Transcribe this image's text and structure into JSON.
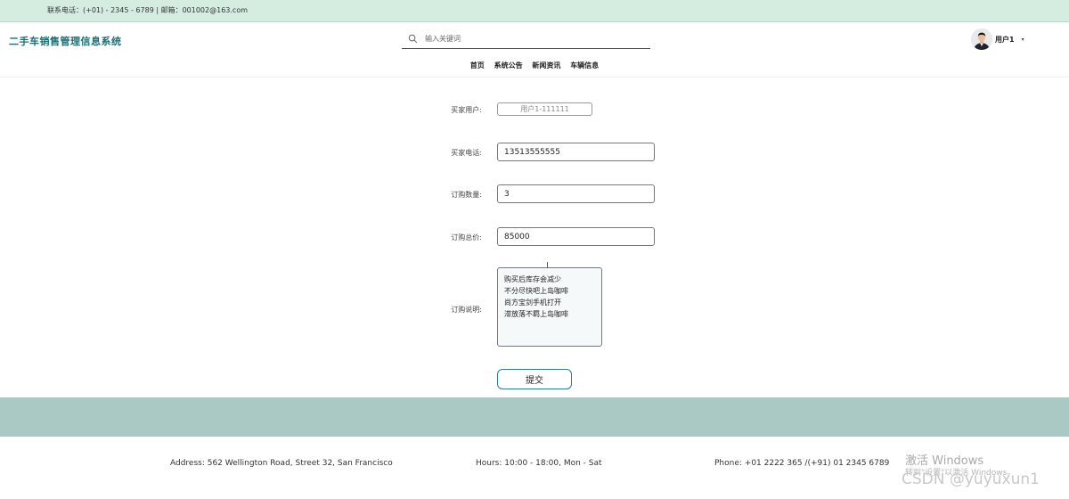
{
  "topbar": {
    "contact": "联系电话：(+01) - 2345 - 6789 | 邮箱：001002@163.com"
  },
  "header": {
    "brand": "二手车销售管理信息系统",
    "search_placeholder": "输入关键词",
    "user_name": "用户1",
    "caret": "▾"
  },
  "nav": {
    "items": [
      "首页",
      "系统公告",
      "新闻资讯",
      "车辆信息"
    ]
  },
  "form": {
    "buyer_user_label": "买家用户:",
    "buyer_user_value": "用户1-111111",
    "buyer_phone_label": "买家电话:",
    "buyer_phone_value": "13513555555",
    "quantity_label": "订购数量:",
    "quantity_value": "3",
    "total_label": "订购总价:",
    "total_value": "85000",
    "desc_label": "订购说明:",
    "desc_value": "购买后库存会减少\n不分尽快吧上岛咖啡\n尚方宝剑手机打开\n滞放落不羁上岛咖啡",
    "submit_label": "提交"
  },
  "footer": {
    "address": "Address: 562 Wellington Road, Street 32, San Francisco",
    "hours": "Hours: 10:00 - 18:00, Mon - Sat",
    "phone": "Phone: +01 2222 365 /(+91) 01 2345 6789"
  },
  "overlay": {
    "windows_activate": "激活 Windows",
    "windows_activate_sub": "转到\"设置\"以激活 Windows。",
    "csdn_watermark": "CSDN @yuyuxun1"
  },
  "colors": {
    "topbar_bg": "#d5ede0",
    "brand": "#1e6c75",
    "band": "#aac8c4",
    "accent": "#2d7f8a"
  }
}
